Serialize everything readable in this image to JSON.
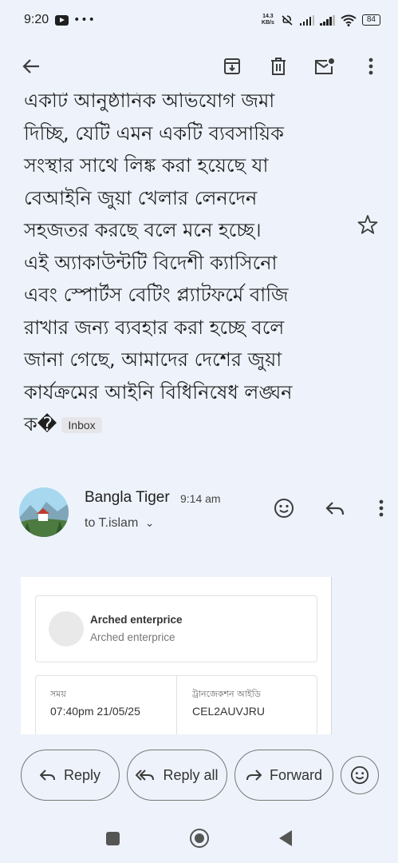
{
  "status_bar": {
    "time": "9:20",
    "net_speed_value": "14.3",
    "net_speed_unit": "KB/s",
    "battery": "84",
    "icons": [
      "youtube-icon",
      "more-dots-icon",
      "mute-icon",
      "signal-icon",
      "signal-icon",
      "wifi-icon",
      "battery-icon"
    ]
  },
  "app_bar": {
    "icons": [
      "back-arrow-icon",
      "archive-icon",
      "delete-icon",
      "mark-unread-icon",
      "more-vert-icon"
    ]
  },
  "email": {
    "body_lines": [
      "একটি আনুষ্ঠানিক অভিযোগ জমা",
      "দিচ্ছি, যেটি এমন একটি ব্যবসায়িক",
      "সংস্থার সাথে লিঙ্ক করা হয়েছে যা",
      "বেআইনি জুয়া খেলার লেনদেন",
      "সহজতর করছে বলে মনে হচ্ছে।",
      "এই অ্যাকাউন্টটি বিদেশী ক্যাসিনো",
      "এবং স্পোর্টস বেটিং প্ল্যাটফর্মে বাজি",
      "রাখার জন্য ব্যবহার করা হচ্ছে বলে",
      "জানা গেছে, আমাদের দেশের জুয়া",
      "কার্যক্রমের আইনি বিধিনিষেধ লঙ্ঘন"
    ],
    "last_line": "ক�",
    "label_chip": "Inbox"
  },
  "sender": {
    "name": "Bangla Tiger",
    "time": "9:14 am",
    "to": "to T.islam",
    "to_chevron": "⌄"
  },
  "embedded_receipt": {
    "merchant_name": "Arched enterprice",
    "merchant_sub": "Arched enterprice",
    "time_label": "সময়",
    "time_value": "07:40pm 21/05/25",
    "txn_label": "ট্রানজেকশন আইডি",
    "txn_value": "CEL2AUVJRU"
  },
  "actions": {
    "reply": "Reply",
    "reply_all": "Reply all",
    "forward": "Forward"
  },
  "colors": {
    "background": "#eef3fb",
    "text": "#1f1f1f",
    "icon": "#3c3c3c"
  }
}
